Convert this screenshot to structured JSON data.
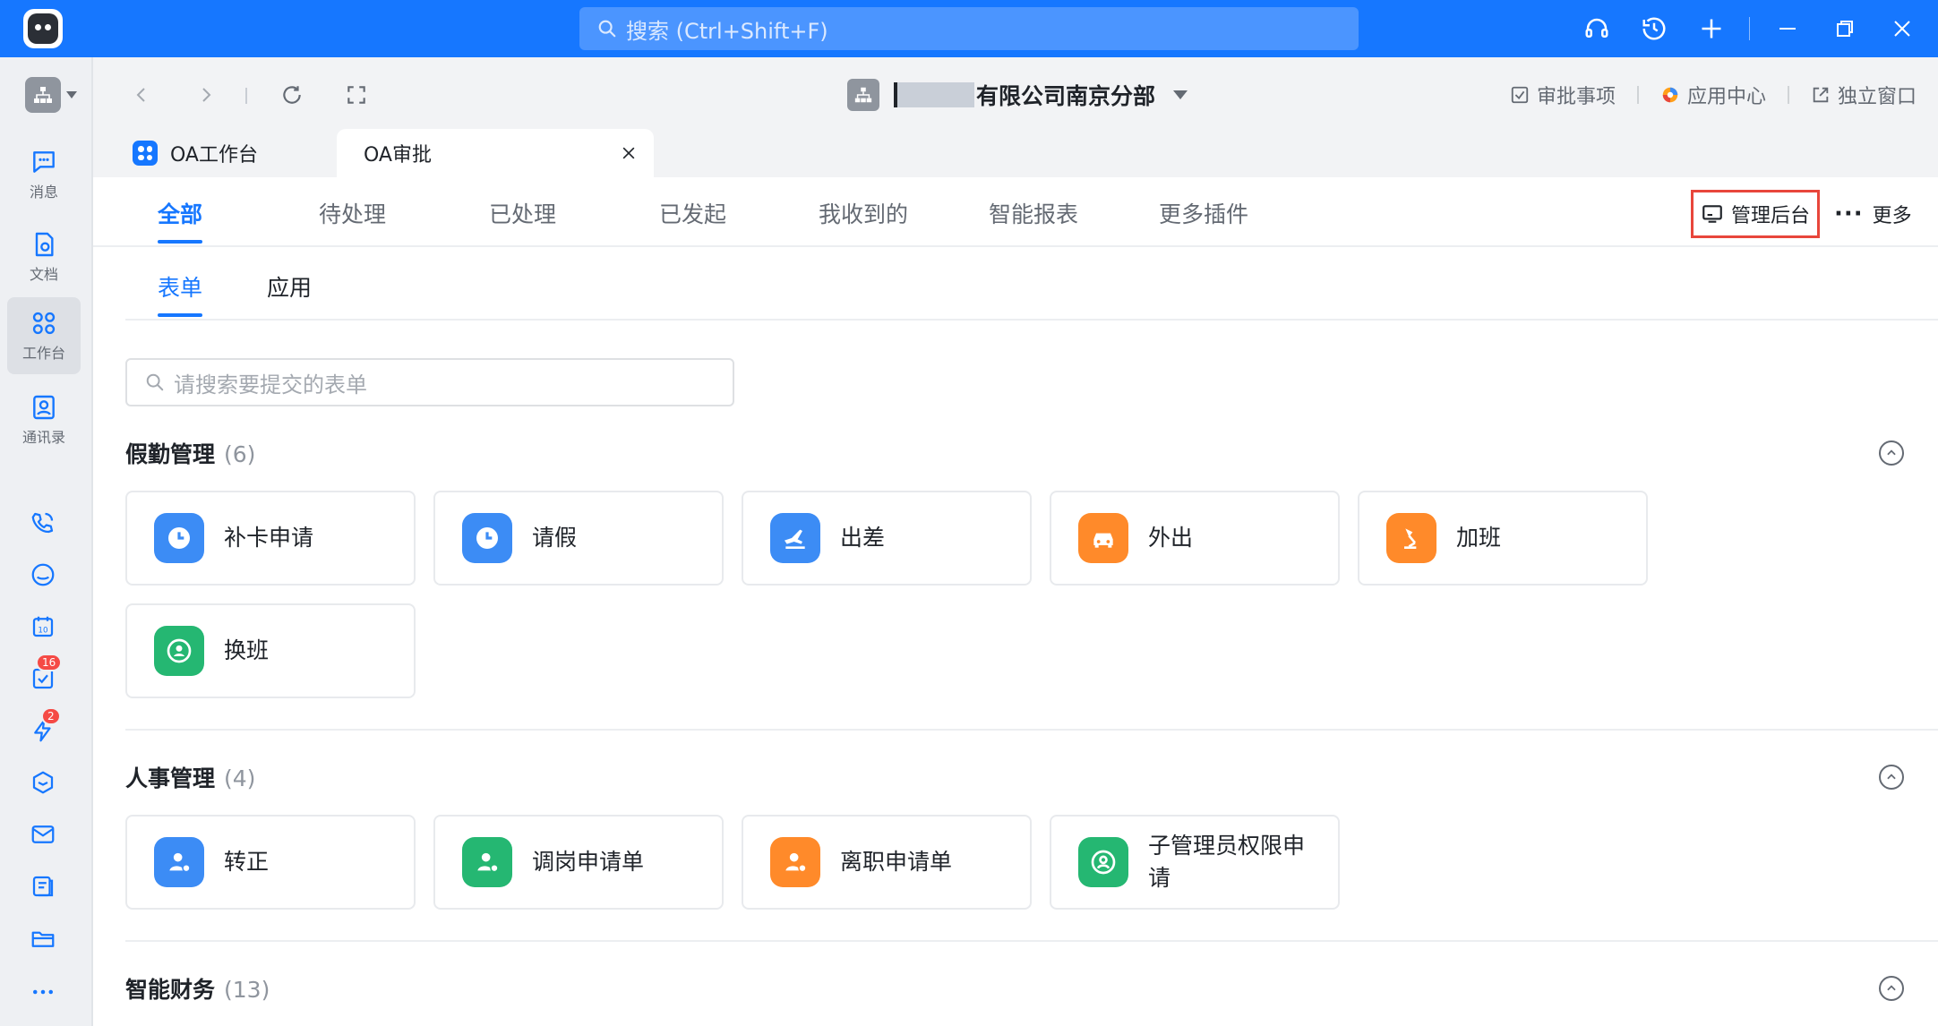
{
  "search": {
    "placeholder": "搜索 (Ctrl+Shift+F)"
  },
  "sidebar": {
    "items": [
      {
        "label": "消息",
        "icon": "message-icon"
      },
      {
        "label": "文档",
        "icon": "document-icon"
      },
      {
        "label": "工作台",
        "icon": "workbench-icon"
      },
      {
        "label": "通讯录",
        "icon": "contacts-icon"
      }
    ],
    "badges": {
      "todo": "16",
      "flash": "2"
    }
  },
  "toolbar": {
    "org_name": "有限公司南京分部",
    "approvals": "审批事项",
    "app_center": "应用中心",
    "standalone": "独立窗口"
  },
  "window_tabs": [
    {
      "label": "OA工作台"
    },
    {
      "label": "OA审批"
    }
  ],
  "page_tabs": [
    "全部",
    "待处理",
    "已处理",
    "已发起",
    "我收到的",
    "智能报表",
    "更多插件"
  ],
  "actions": {
    "admin": "管理后台",
    "more": "更多"
  },
  "sub_tabs": [
    "表单",
    "应用"
  ],
  "form_search": {
    "placeholder": "请搜索要提交的表单"
  },
  "sections": [
    {
      "title": "假勤管理",
      "count": "(6)",
      "items": [
        {
          "label": "补卡申请",
          "color": "#3c8cf5",
          "icon": "clock-icon"
        },
        {
          "label": "请假",
          "color": "#3c8cf5",
          "icon": "clock-icon"
        },
        {
          "label": "出差",
          "color": "#3c8cf5",
          "icon": "airplane-icon"
        },
        {
          "label": "外出",
          "color": "#ff8a2a",
          "icon": "car-icon"
        },
        {
          "label": "加班",
          "color": "#ff8a2a",
          "icon": "desk-lamp-icon"
        },
        {
          "label": "换班",
          "color": "#25b772",
          "icon": "swap-user-icon"
        }
      ]
    },
    {
      "title": "人事管理",
      "count": "(4)",
      "items": [
        {
          "label": "转正",
          "color": "#3c8cf5",
          "icon": "user-check-icon"
        },
        {
          "label": "调岗申请单",
          "color": "#25b772",
          "icon": "user-transfer-icon"
        },
        {
          "label": "离职申请单",
          "color": "#ff8a2a",
          "icon": "user-leave-icon"
        },
        {
          "label": "子管理员权限申请",
          "color": "#25b772",
          "icon": "user-circle-icon"
        }
      ]
    },
    {
      "title": "智能财务",
      "count": "(13)"
    }
  ]
}
